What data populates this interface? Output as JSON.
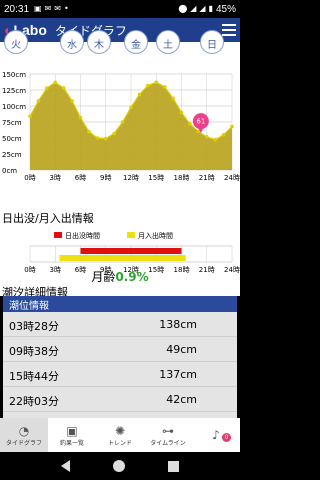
{
  "status": {
    "time": "20:31",
    "battery": "45%",
    "notification_icons": [
      "photo-icon",
      "mail-icon",
      "mail-icon",
      "dot-icon"
    ]
  },
  "app": {
    "logo_text": "Labo",
    "title": "タイドグラフ"
  },
  "days": [
    "火",
    "水",
    "木",
    "金",
    "土",
    "日"
  ],
  "chart_data": {
    "type": "area",
    "x_unit": "hour",
    "x_ticks": [
      "0時",
      "3時",
      "6時",
      "9時",
      "12時",
      "15時",
      "18時",
      "21時",
      "24時"
    ],
    "y_ticks": [
      "150cm",
      "125cm",
      "100cm",
      "75cm",
      "50cm",
      "25cm",
      "0cm"
    ],
    "ylim": [
      0,
      150
    ],
    "xlim": [
      0,
      24
    ],
    "x": [
      0,
      1,
      2,
      3,
      4,
      5,
      6,
      7,
      8,
      9,
      10,
      11,
      12,
      13,
      14,
      15,
      16,
      17,
      18,
      19,
      20,
      21,
      22,
      23,
      24
    ],
    "values": [
      84,
      108,
      128,
      137,
      128,
      108,
      82,
      60,
      50,
      49,
      57,
      75,
      98,
      118,
      132,
      137,
      130,
      112,
      90,
      72,
      60,
      52,
      47,
      55,
      68
    ],
    "current_marker": {
      "x": 20.3,
      "value": "61"
    },
    "fill_color": "#b8a21a",
    "line_color": "#ddd000",
    "marker_color": "#ee3f8a"
  },
  "sun_moon": {
    "title": "日出没/月入出情報",
    "legend_sun": "日出没時間",
    "legend_moon": "月入出時間",
    "sun_color": "#e01010",
    "moon_color": "#eee010",
    "sun_range": [
      6,
      18
    ],
    "moon_range": [
      3.5,
      18.5
    ],
    "x_ticks": [
      "0時",
      "3時",
      "6時",
      "9時",
      "12時",
      "15時",
      "18時",
      "21時",
      "24時"
    ]
  },
  "moon_age": {
    "label": "月齢",
    "value": "0.9%"
  },
  "tide_detail": {
    "title": "潮汐詳細情報",
    "header": "潮位情報",
    "rows": [
      {
        "time": "03時28分",
        "height": "138cm"
      },
      {
        "time": "09時38分",
        "height": "49cm"
      },
      {
        "time": "15時44分",
        "height": "137cm"
      },
      {
        "time": "22時03分",
        "height": "42cm"
      }
    ]
  },
  "tabs": [
    {
      "label": "タイドグラフ",
      "icon": "clock-icon"
    },
    {
      "label": "釣果一覧",
      "icon": "photo-icon"
    },
    {
      "label": "トレンド",
      "icon": "bulb-icon"
    },
    {
      "label": "タイムライン",
      "icon": "timeline-icon"
    },
    {
      "label": "",
      "icon": "bell-icon",
      "badge": "0"
    }
  ]
}
